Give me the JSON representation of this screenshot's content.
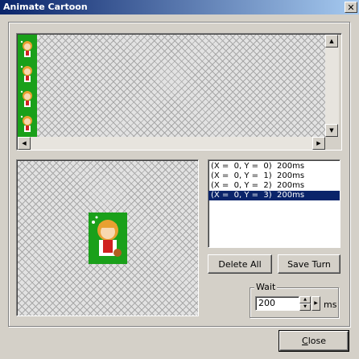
{
  "window": {
    "title": "Animate Cartoon",
    "close_glyph": "✕"
  },
  "sprite_sheet": {
    "sprite_color": "#1aa01a",
    "cells": 4
  },
  "frame_list": {
    "items": [
      {
        "label": "(X =  0, Y =  0)  200ms",
        "selected": false
      },
      {
        "label": "(X =  0, Y =  1)  200ms",
        "selected": false
      },
      {
        "label": "(X =  0, Y =  2)  200ms",
        "selected": false
      },
      {
        "label": "(X =  0, Y =  3)  200ms",
        "selected": true
      }
    ]
  },
  "buttons": {
    "delete_all": "Delete All",
    "save_turn": "Save Turn",
    "close_rest": "lose",
    "close_mnemonic": "C"
  },
  "wait": {
    "label": "Wait",
    "value": "200",
    "unit": "ms"
  },
  "icons": {
    "scroll_up": "up-arrow-icon",
    "scroll_down": "down-arrow-icon",
    "scroll_left": "left-arrow-icon",
    "scroll_right": "right-arrow-icon"
  }
}
